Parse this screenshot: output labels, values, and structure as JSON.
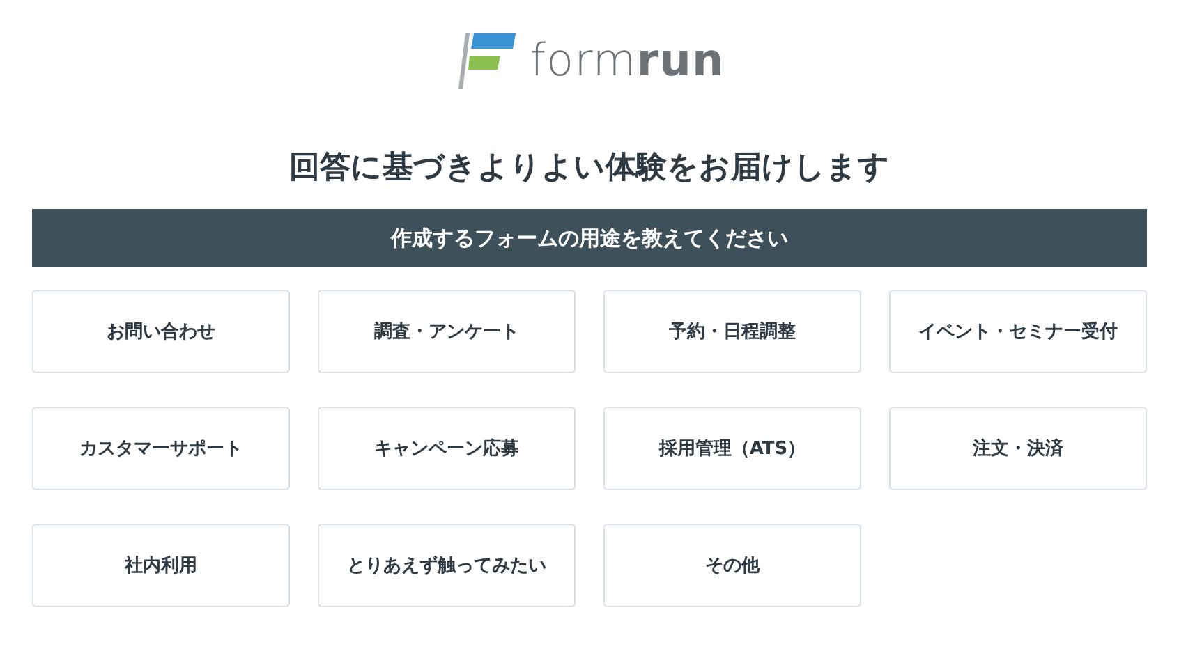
{
  "logo": {
    "text": "form**run**"
  },
  "heading": "回答に基づきよりよい体験をお届けします",
  "banner": "作成するフォームの用途を教えてください",
  "options": [
    {
      "label": "お問い合わせ",
      "selected": false
    },
    {
      "label": "調査・アンケート",
      "selected": false
    },
    {
      "label": "予約・日程調整",
      "selected": false
    },
    {
      "label": "イベント・セミナー受付",
      "selected": false
    },
    {
      "label": "カスタマーサポート",
      "selected": false
    },
    {
      "label": "キャンペーン応募",
      "selected": false
    },
    {
      "label": "採用管理（ATS）",
      "selected": false
    },
    {
      "label": "注文・決済",
      "selected": false
    },
    {
      "label": "社内利用",
      "selected": false
    },
    {
      "label": "とりあえず触ってみたい",
      "selected": false
    },
    {
      "label": "その他",
      "selected": false
    }
  ]
}
